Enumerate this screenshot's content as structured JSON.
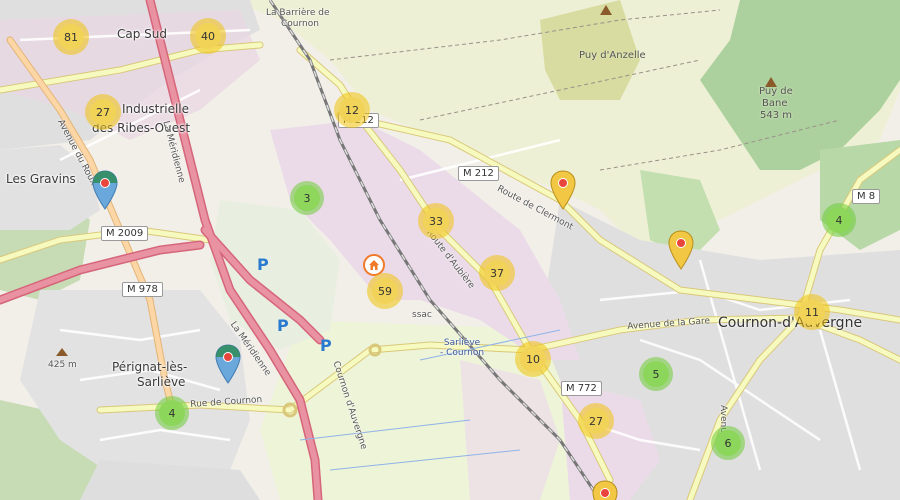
{
  "places": {
    "cap_sud": "Cap Sud",
    "zone_industrielle_1": "Industrielle",
    "zone_industrielle_2": "des Ribes-Ouest",
    "les_gravins": "Les Gravins",
    "barriere_1": "La Barrière de",
    "barriere_2": "Cournon",
    "cournon": "Cournon-d'Auvergne",
    "perignat_1": "Pérignat-lès-",
    "perignat_2": "Sarliève",
    "elev_425": "425 m"
  },
  "peaks": {
    "anzelle": "Puy d'Anzelle",
    "bane_1": "Puy de",
    "bane_2": "Bane",
    "bane_elev": "543 m"
  },
  "streets": {
    "meridienne_1": "La Méridienne",
    "meridienne_2": "La Méridienne",
    "avenue_roux": "Avenue du Roux",
    "route_clermont": "Route de Clermont",
    "route_aubiere": "Route d'Aubière",
    "avenue_gare": "Avenue de la Gare",
    "rue_cournon": "Rue de Cournon",
    "cournon_auvergne": "Cournon d'Auvergne",
    "avenue_right": "Avenue",
    "lassac": "ssac"
  },
  "shields": {
    "m212": "M 212",
    "m2009": "M 2009",
    "m978": "M 978",
    "m772": "M 772",
    "m8": "M 8",
    "m212b": "M 212"
  },
  "station": {
    "line1": "Sarliève",
    "line2": "- Cournon"
  },
  "parking_symbol": "P",
  "clusters": [
    {
      "name": "cluster-81",
      "count": "81",
      "color": "yellow"
    },
    {
      "name": "cluster-40",
      "count": "40",
      "color": "yellow"
    },
    {
      "name": "cluster-27-nw",
      "count": "27",
      "color": "yellow"
    },
    {
      "name": "cluster-12",
      "count": "12",
      "color": "yellow"
    },
    {
      "name": "cluster-3",
      "count": "3",
      "color": "green"
    },
    {
      "name": "cluster-33",
      "count": "33",
      "color": "yellow"
    },
    {
      "name": "cluster-37",
      "count": "37",
      "color": "yellow"
    },
    {
      "name": "cluster-59",
      "count": "59",
      "color": "yellow"
    },
    {
      "name": "cluster-10",
      "count": "10",
      "color": "yellow"
    },
    {
      "name": "cluster-27-s",
      "count": "27",
      "color": "yellow"
    },
    {
      "name": "cluster-5",
      "count": "5",
      "color": "green"
    },
    {
      "name": "cluster-6",
      "count": "6",
      "color": "green"
    },
    {
      "name": "cluster-4-e",
      "count": "4",
      "color": "green"
    },
    {
      "name": "cluster-11",
      "count": "11",
      "color": "yellow"
    },
    {
      "name": "cluster-4-sw",
      "count": "4",
      "color": "green"
    }
  ],
  "colors": {
    "cluster_yellow": "#f1d357",
    "cluster_green": "#8cd65a",
    "marker_blue": "#6aa8dc",
    "marker_yellow": "#f2c744",
    "marker_red_dot": "#e8453c",
    "motorway": "#e892a2",
    "primary_road": "#fcd6a4",
    "secondary_road": "#f7fabf",
    "residential_area": "#e0dfdf",
    "industrial_area": "#ebdbe8",
    "forest": "#add19e",
    "farmland": "#eef0d5"
  }
}
